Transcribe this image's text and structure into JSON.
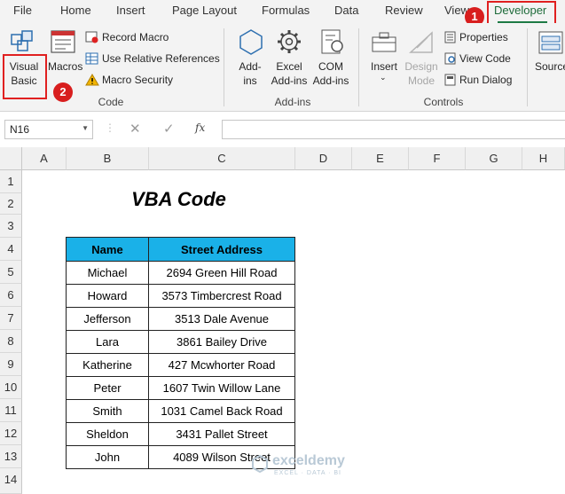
{
  "tabs": [
    "File",
    "Home",
    "Insert",
    "Page Layout",
    "Formulas",
    "Data",
    "Review",
    "View",
    "Developer"
  ],
  "badges": {
    "one": "1",
    "two": "2"
  },
  "ribbon": {
    "code_group": {
      "visual_basic_line1": "Visual",
      "visual_basic_line2": "Basic",
      "macros": "Macros",
      "record_macro": "Record Macro",
      "relative_refs": "Use Relative References",
      "macro_security": "Macro Security",
      "label": "Code"
    },
    "addins_group": {
      "addins_line1": "Add-",
      "addins_line2": "ins",
      "excel_addins_line1": "Excel",
      "excel_addins_line2": "Add-ins",
      "com_addins_line1": "COM",
      "com_addins_line2": "Add-ins",
      "label": "Add-ins"
    },
    "controls_group": {
      "insert": "Insert",
      "design_mode_line1": "Design",
      "design_mode_line2": "Mode",
      "properties": "Properties",
      "view_code": "View Code",
      "run_dialog": "Run Dialog",
      "label": "Controls"
    },
    "xml_group": {
      "source": "Source"
    }
  },
  "formula_bar": {
    "name_box": "N16",
    "fx": "fx",
    "value": ""
  },
  "columns": [
    "A",
    "B",
    "C",
    "D",
    "E",
    "F",
    "G",
    "H"
  ],
  "rows": [
    "1",
    "2",
    "3",
    "4",
    "5",
    "6",
    "7",
    "8",
    "9",
    "10",
    "11",
    "12",
    "13",
    "14"
  ],
  "sheet": {
    "title": "VBA Code",
    "headers": {
      "name": "Name",
      "address": "Street Address"
    },
    "records": [
      {
        "name": "Michael",
        "address": "2694 Green Hill Road"
      },
      {
        "name": "Howard",
        "address": "3573 Timbercrest Road"
      },
      {
        "name": "Jefferson",
        "address": "3513 Dale Avenue"
      },
      {
        "name": "Lara",
        "address": "3861 Bailey Drive"
      },
      {
        "name": "Katherine",
        "address": "427 Mcwhorter Road"
      },
      {
        "name": "Peter",
        "address": "1607 Twin Willow Lane"
      },
      {
        "name": "Smith",
        "address": "1031 Camel Back Road"
      },
      {
        "name": "Sheldon",
        "address": "3431 Pallet Street"
      },
      {
        "name": "John",
        "address": "4089 Wilson Street"
      }
    ]
  },
  "watermark": {
    "brand": "exceldemy",
    "tagline": "EXCEL · DATA · BI"
  },
  "colors": {
    "accent_red": "#e02020",
    "table_header": "#1ab1e8",
    "developer_green": "#1e7a45"
  }
}
